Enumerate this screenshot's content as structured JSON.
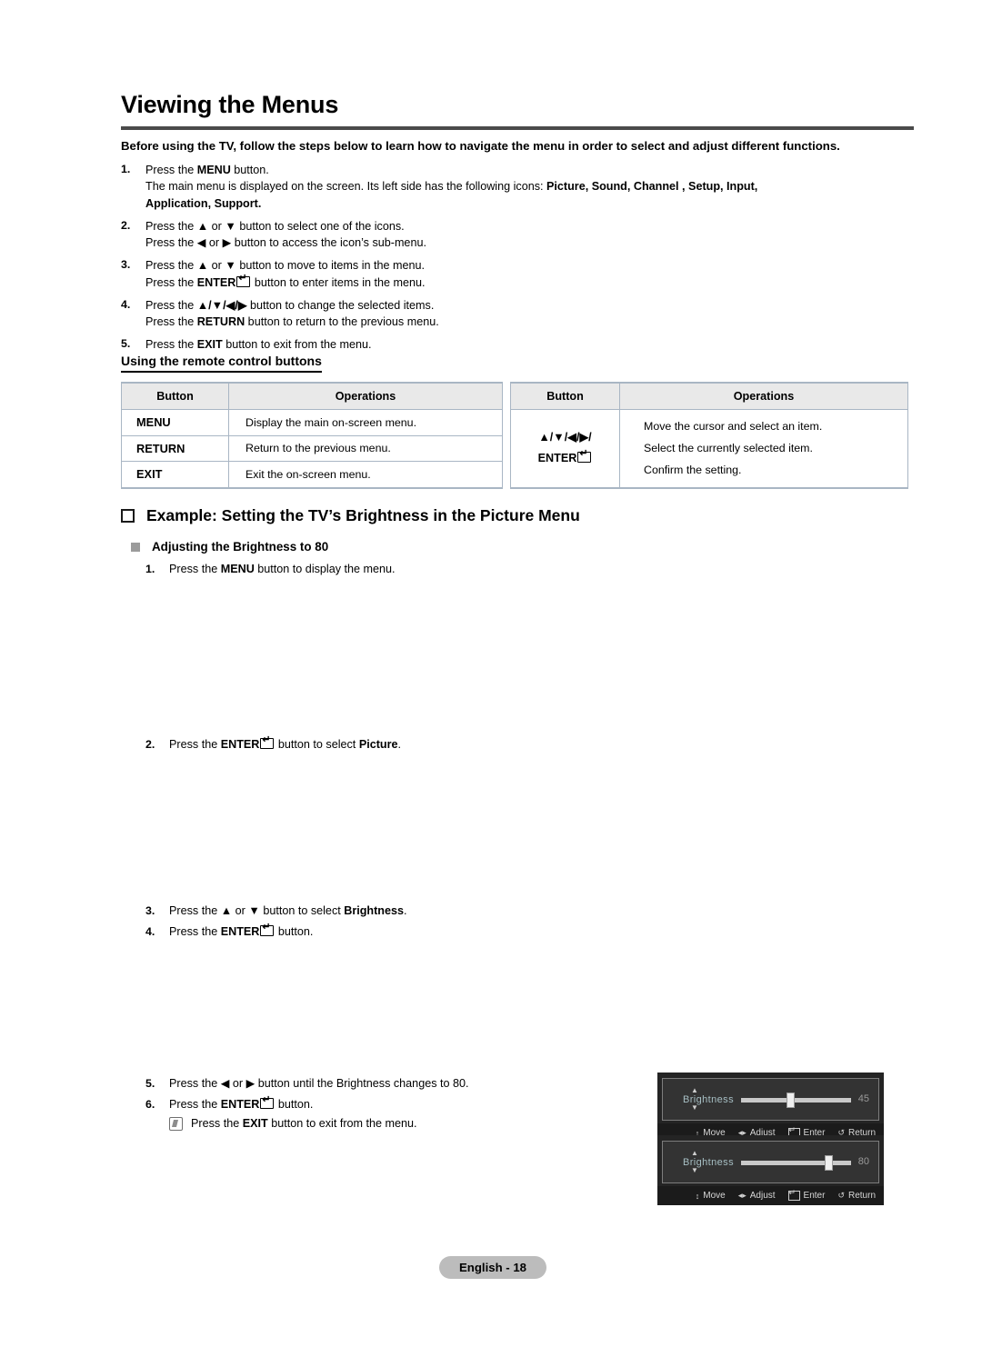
{
  "document": {
    "title": "Viewing the Menus",
    "intro": "Before using the TV, follow the steps below to learn how to navigate the menu in order to select and adjust different functions."
  },
  "steps_top": [
    {
      "num": "1.",
      "lines": [
        "Press the MENU button.",
        "The main menu is displayed on the screen. Its left side has the following icons: Picture, Sound, Channel , Setup, Input,",
        "Application, Support."
      ]
    },
    {
      "num": "2.",
      "lines": [
        "Press the ▲ or ▼ button to select one of the icons.",
        "Press the ◀ or ▶ button to access the icon’s sub-menu."
      ]
    },
    {
      "num": "3.",
      "lines": [
        "Press the ▲ or ▼ button to move to items in the menu.",
        "Press the ENTER button to enter items in the menu."
      ]
    },
    {
      "num": "4.",
      "lines": [
        "Press the ▲/▼/◀/▶ button to change the selected items.",
        "Press the RETURN button to return to the previous menu."
      ]
    },
    {
      "num": "5.",
      "lines": [
        "Press the EXIT button to exit from the menu."
      ]
    }
  ],
  "remote_section": {
    "heading": "Using the remote control buttons",
    "left_table": {
      "headers": [
        "Button",
        "Operations"
      ],
      "rows": [
        {
          "button": "MENU",
          "operation": "Display the main on-screen menu."
        },
        {
          "button": "RETURN",
          "operation": "Return to the previous menu."
        },
        {
          "button": "EXIT",
          "operation": "Exit the on-screen menu."
        }
      ]
    },
    "right_table": {
      "headers": [
        "Button",
        "Operations"
      ],
      "button_keys": [
        "▲/▼/◀/▶/",
        "ENTER"
      ],
      "operations": [
        "Move the cursor and select an item.",
        "Select the currently selected item.",
        "Confirm the setting."
      ]
    }
  },
  "example": {
    "heading": "Example: Setting the TV’s Brightness in the Picture Menu",
    "subheading": "Adjusting the Brightness to 80",
    "step1": {
      "num": "1.",
      "text_a": "Press the ",
      "bold": "MENU",
      "text_b": " button to display the menu."
    },
    "step2": {
      "num": "2.",
      "text_a": "Press the ",
      "bold": "ENTER",
      "text_b": " button to select ",
      "bold2": "Picture",
      "text_c": "."
    },
    "step3": {
      "num": "3.",
      "text_a": "Press the ▲ or ▼ button to select ",
      "bold": "Brightness",
      "text_b": "."
    },
    "step4": {
      "num": "4.",
      "text_a": "Press the ",
      "bold": "ENTER",
      "text_b": " button."
    },
    "step5": {
      "num": "5.",
      "text": "Press the ◀ or ▶ button until the Brightness changes to 80."
    },
    "step6": {
      "num": "6.",
      "text_a": "Press the ",
      "bold": "ENTER",
      "text_b": " button."
    },
    "note": {
      "text_a": "Press the ",
      "bold": "EXIT",
      "text_b": " button to exit from the menu."
    }
  },
  "osd_widgets": [
    {
      "label": "Brightness",
      "value": "45",
      "percent": 45,
      "bar": [
        {
          "glyph": "↕",
          "text": "Move"
        },
        {
          "glyph": "◂▸",
          "text": "Adjust"
        },
        {
          "glyph": "enter",
          "text": "Enter"
        },
        {
          "glyph": "↺",
          "text": "Return"
        }
      ]
    },
    {
      "label": "Brightness",
      "value": "80",
      "percent": 80,
      "bar": [
        {
          "glyph": "↕",
          "text": "Move"
        },
        {
          "glyph": "◂▸",
          "text": "Adjust"
        },
        {
          "glyph": "enter",
          "text": "Enter"
        },
        {
          "glyph": "↺",
          "text": "Return"
        }
      ]
    }
  ],
  "footer": {
    "page_label": "English - 18"
  },
  "colors": {
    "rule": "#4a4a4a",
    "table_header_bg": "#e9e9e9",
    "table_border": "#a9b6c4",
    "osd_bg": "#242424",
    "osd_panel": "#333333",
    "osd_label": "#a7bfc4",
    "footer_bg": "#bcbcbc"
  }
}
